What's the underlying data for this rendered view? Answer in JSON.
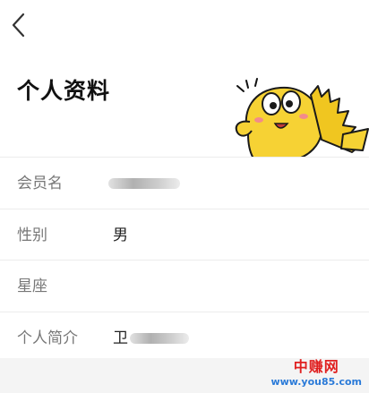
{
  "header": {
    "back_icon": "chevron-left-icon",
    "title": "个人资料",
    "mascot": "yellow-fish-mascot"
  },
  "profile": {
    "rows": [
      {
        "label": "会员名",
        "value": "",
        "value_redacted": true
      },
      {
        "label": "性别",
        "value": "男",
        "value_redacted": false
      },
      {
        "label": "星座",
        "value": "",
        "value_redacted": false
      },
      {
        "label": "个人简介",
        "value": "卫",
        "value_redacted": true
      }
    ]
  },
  "watermark": {
    "title": "中赚网",
    "url": "www.you85.com"
  },
  "colors": {
    "label": "#777777",
    "value": "#222222",
    "divider": "#ececec",
    "mascot_yellow": "#f6d234",
    "watermark_red": "#e02020",
    "watermark_blue": "#2a7ad8"
  }
}
